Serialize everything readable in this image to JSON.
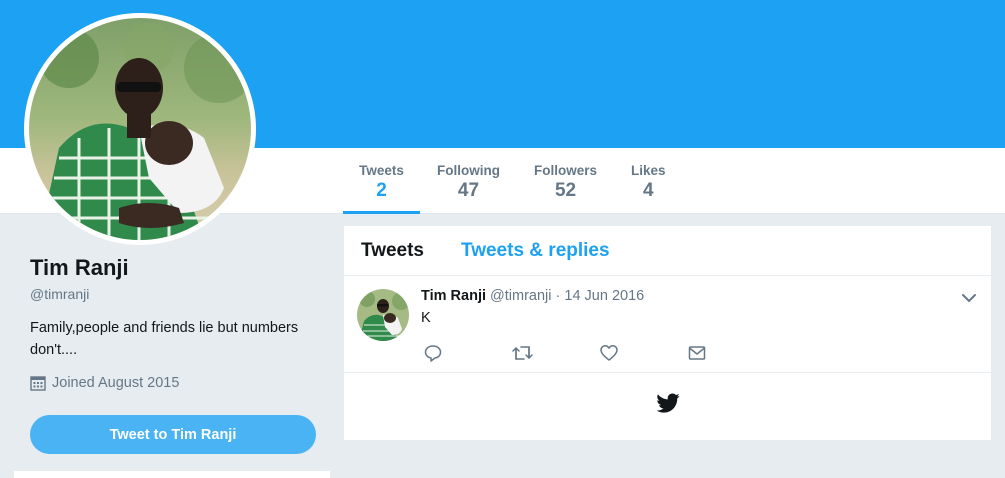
{
  "profile": {
    "name": "Tim Ranji",
    "handle": "@timranji",
    "bio": "Family,people and friends lie but numbers don't....",
    "joined": "Joined August 2015",
    "tweet_to_label": "Tweet to Tim Ranji"
  },
  "stats": [
    {
      "label": "Tweets",
      "value": "2"
    },
    {
      "label": "Following",
      "value": "47"
    },
    {
      "label": "Followers",
      "value": "52"
    },
    {
      "label": "Likes",
      "value": "4"
    }
  ],
  "timeline": {
    "tabs": [
      {
        "label": "Tweets"
      },
      {
        "label": "Tweets & replies"
      }
    ],
    "tweet": {
      "name": "Tim Ranji",
      "handle": "@timranji",
      "separator": "·",
      "date": "14 Jun 2016",
      "text": "K"
    }
  },
  "icons": {
    "calendar": "calendar-icon",
    "reply": "reply-icon",
    "retweet": "retweet-icon",
    "like": "heart-icon",
    "message": "envelope-icon",
    "caret": "chevron-down-icon",
    "logo": "twitter-bird-icon"
  },
  "colors": {
    "brand": "#1da1f2",
    "button": "#4ab3f4",
    "muted": "#657786",
    "background": "#e6ecf0"
  }
}
